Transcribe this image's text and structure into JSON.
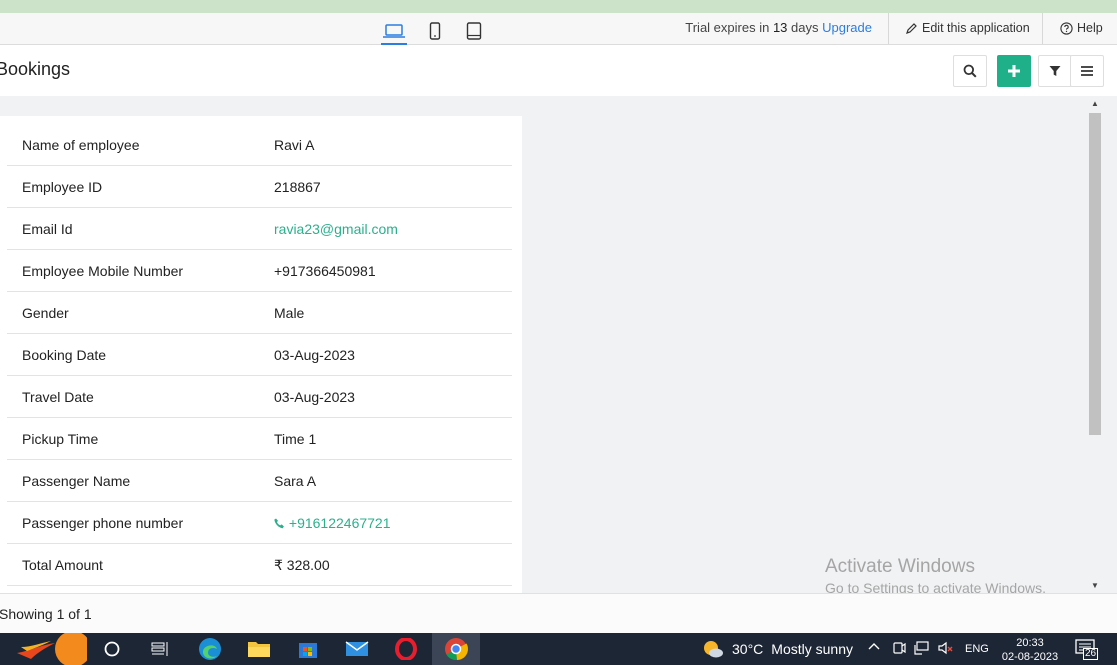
{
  "topbar": {
    "trial_prefix": "Trial expires in",
    "trial_days": "13",
    "trial_suffix": "days",
    "upgrade_label": "Upgrade",
    "edit_label": "Edit this application",
    "help_label": "Help",
    "devices": [
      "laptop-icon",
      "phone-icon",
      "tablet-icon"
    ],
    "active_device": "laptop-icon"
  },
  "header": {
    "title": "Bookings",
    "buttons": [
      "search-icon",
      "plus-icon",
      "filter-icon",
      "menu-icon"
    ]
  },
  "record": {
    "fields": [
      {
        "label": "Name of employee",
        "value": "Ravi A"
      },
      {
        "label": "Employee ID",
        "value": "218867"
      },
      {
        "label": "Email Id",
        "value": "ravia23@gmail.com"
      },
      {
        "label": "Employee Mobile Number",
        "value": "+917366450981"
      },
      {
        "label": "Gender",
        "value": "Male"
      },
      {
        "label": "Booking Date",
        "value": "03-Aug-2023"
      },
      {
        "label": "Travel Date",
        "value": "03-Aug-2023"
      },
      {
        "label": "Pickup Time",
        "value": "Time 1"
      },
      {
        "label": "Passenger Name",
        "value": "Sara A"
      },
      {
        "label": "Passenger phone number",
        "value": "+916122467721"
      },
      {
        "label": "Total Amount",
        "value": "₹ 328.00"
      }
    ]
  },
  "watermark": {
    "line1": "Activate Windows",
    "line2": "Go to Settings to activate Windows."
  },
  "footer": {
    "showing": "Showing 1 of 1"
  },
  "taskbar": {
    "weather_temp": "30°C",
    "weather_desc": "Mostly sunny",
    "language": "ENG",
    "time": "20:33",
    "date": "02-08-2023",
    "notification_count": "26"
  },
  "colors": {
    "accent": "#1fb08a",
    "link": "#2bb08b",
    "upgrade": "#2a7de1",
    "taskbar": "#1d2635"
  }
}
